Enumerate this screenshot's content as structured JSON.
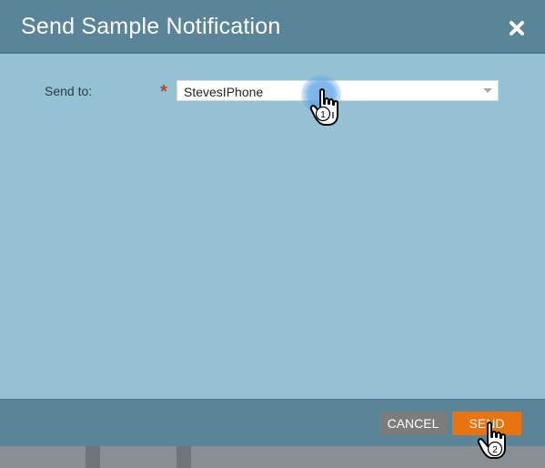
{
  "dialog": {
    "title": "Send Sample Notification",
    "close_icon": "close-icon"
  },
  "form": {
    "send_to_label": "Send to:",
    "required_marker": "*",
    "send_to_value": "StevesIPhone",
    "caret_icon": "chevron-down-icon"
  },
  "footer": {
    "cancel_label": "CANCEL",
    "send_label": "SEND"
  },
  "annotations": {
    "step1": "1",
    "step2": "2"
  },
  "colors": {
    "header": "#5a8599",
    "body": "#95c2d3",
    "send_button": "#e8740f",
    "cancel_button": "#7c7c7c"
  }
}
